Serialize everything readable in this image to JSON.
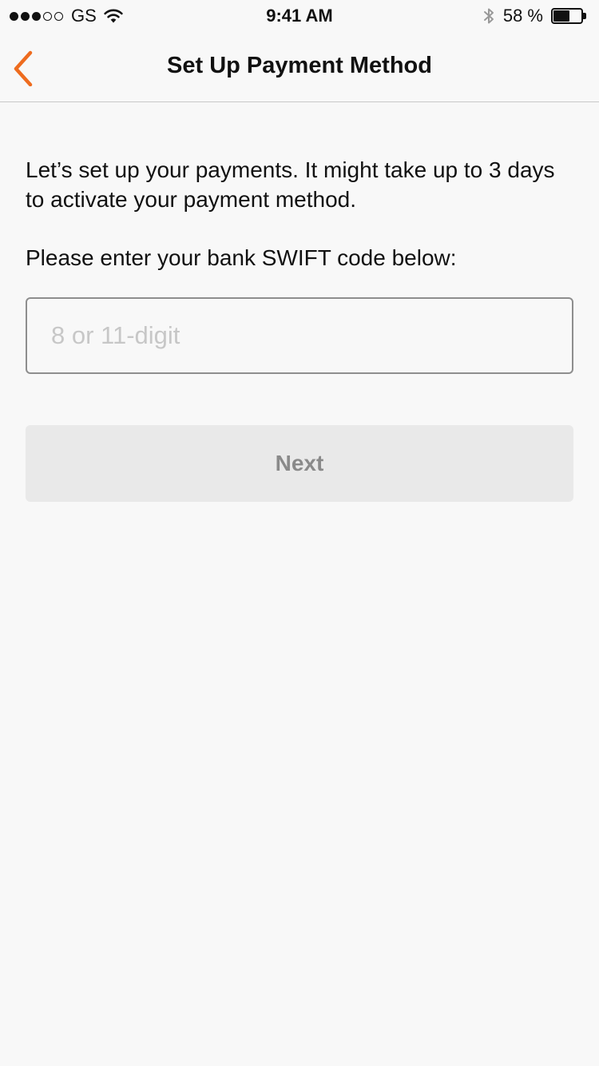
{
  "status_bar": {
    "carrier": "GS",
    "signal_strength": 3,
    "signal_max": 5,
    "time": "9:41 AM",
    "battery_percent": "58 %",
    "battery_level": 0.58
  },
  "nav": {
    "title": "Set Up Payment Method",
    "back_icon": "chevron-left-icon",
    "accent_color": "#ee6c1f"
  },
  "content": {
    "intro": "Let’s set up your payments. It might take up to 3 days to activate your payment method.",
    "prompt": "Please enter your bank SWIFT code below:",
    "swift_input": {
      "value": "",
      "placeholder": "8 or 11-digit"
    },
    "next_label": "Next"
  }
}
